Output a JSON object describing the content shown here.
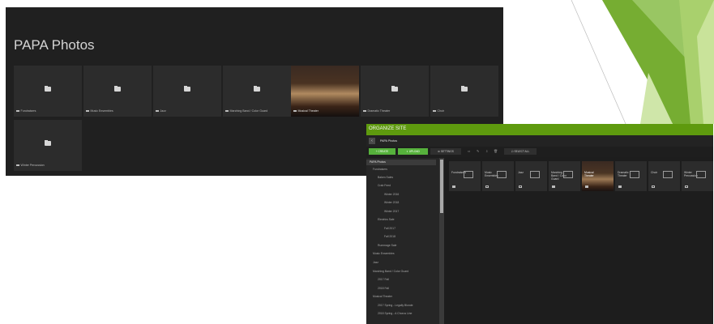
{
  "gallery": {
    "title": "PAPA Photos",
    "tiles": [
      {
        "label": "Fundraisers"
      },
      {
        "label": "Music Ensembles"
      },
      {
        "label": "Jazz"
      },
      {
        "label": "Marching Band / Color Guard"
      },
      {
        "label": "Musical Theater"
      },
      {
        "label": "Dramatic Theater"
      },
      {
        "label": "Choir"
      },
      {
        "label": "Winter Percussion"
      }
    ]
  },
  "organize": {
    "title": "ORGANIZE SITE",
    "path": "PAPA Photos",
    "toolbar": {
      "create": "+ CREATE",
      "upload": "⇪ UPLOAD",
      "settings": "⚙ SETTINGS",
      "select_all": "☑ SELECT ALL"
    },
    "tree": [
      "PAPA Photos",
      "Fundraisers",
      "Baken Sales",
      "Crab Feed",
      "Winter 2016",
      "Winter 2018",
      "Winter 2017",
      "Electrics Sale",
      "Fall 2017",
      "Fall 2018",
      "Rummage Sale",
      "Music Ensembles",
      "Jazz",
      "Marching Band / Color Guard",
      "2017 Fall",
      "2018 Fall",
      "Musical Theater",
      "2017 Spring - Legally Blonde",
      "2018 Spring - A Chorus Line"
    ],
    "grid": [
      {
        "name": "Fundraisers"
      },
      {
        "name": "Music Ensembles"
      },
      {
        "name": "Jazz"
      },
      {
        "name": "Marching Band / Color Guard"
      },
      {
        "name": "Musical Theater"
      },
      {
        "name": "Dramatic Theater"
      },
      {
        "name": "Choir"
      },
      {
        "name": "Winter Percussion"
      }
    ]
  }
}
